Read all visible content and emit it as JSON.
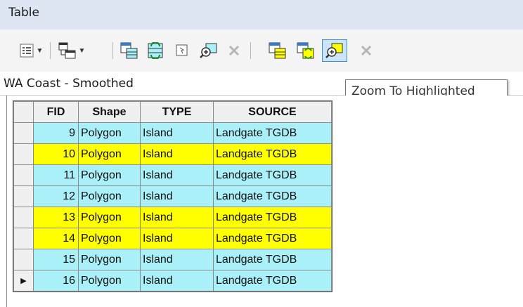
{
  "window": {
    "title": "Table"
  },
  "tab": {
    "label": "WA Coast - Smoothed"
  },
  "tooltip": {
    "text": "Zoom To Highlighted"
  },
  "toolbar": {
    "icons": [
      "table-options-icon",
      "related-tables-icon",
      "select-by-attributes-icon",
      "switch-selection-icon",
      "clear-selection-icon",
      "zoom-to-selected-icon",
      "delete-selected-icon",
      "highlight-icon",
      "switch-highlight-icon",
      "zoom-to-highlighted-icon",
      "delete-highlighted-icon"
    ]
  },
  "colors": {
    "highlight": "#ffff00",
    "selected": "#aaf0f8",
    "header": "#f0f0f0",
    "titlebar": "#dde6f2"
  },
  "table": {
    "columns": [
      "FID",
      "Shape",
      "TYPE",
      "SOURCE"
    ],
    "rows": [
      {
        "fid": "9",
        "shape": "Polygon",
        "type": "Island",
        "source": "Landgate TGDB",
        "highlighted": false,
        "current": false
      },
      {
        "fid": "10",
        "shape": "Polygon",
        "type": "Island",
        "source": "Landgate TGDB",
        "highlighted": true,
        "current": false
      },
      {
        "fid": "11",
        "shape": "Polygon",
        "type": "Island",
        "source": "Landgate TGDB",
        "highlighted": false,
        "current": false
      },
      {
        "fid": "12",
        "shape": "Polygon",
        "type": "Island",
        "source": "Landgate TGDB",
        "highlighted": false,
        "current": false
      },
      {
        "fid": "13",
        "shape": "Polygon",
        "type": "Island",
        "source": "Landgate TGDB",
        "highlighted": true,
        "current": false
      },
      {
        "fid": "14",
        "shape": "Polygon",
        "type": "Island",
        "source": "Landgate TGDB",
        "highlighted": true,
        "current": false
      },
      {
        "fid": "15",
        "shape": "Polygon",
        "type": "Island",
        "source": "Landgate TGDB",
        "highlighted": false,
        "current": false
      },
      {
        "fid": "16",
        "shape": "Polygon",
        "type": "Island",
        "source": "Landgate TGDB",
        "highlighted": false,
        "current": true
      }
    ]
  }
}
